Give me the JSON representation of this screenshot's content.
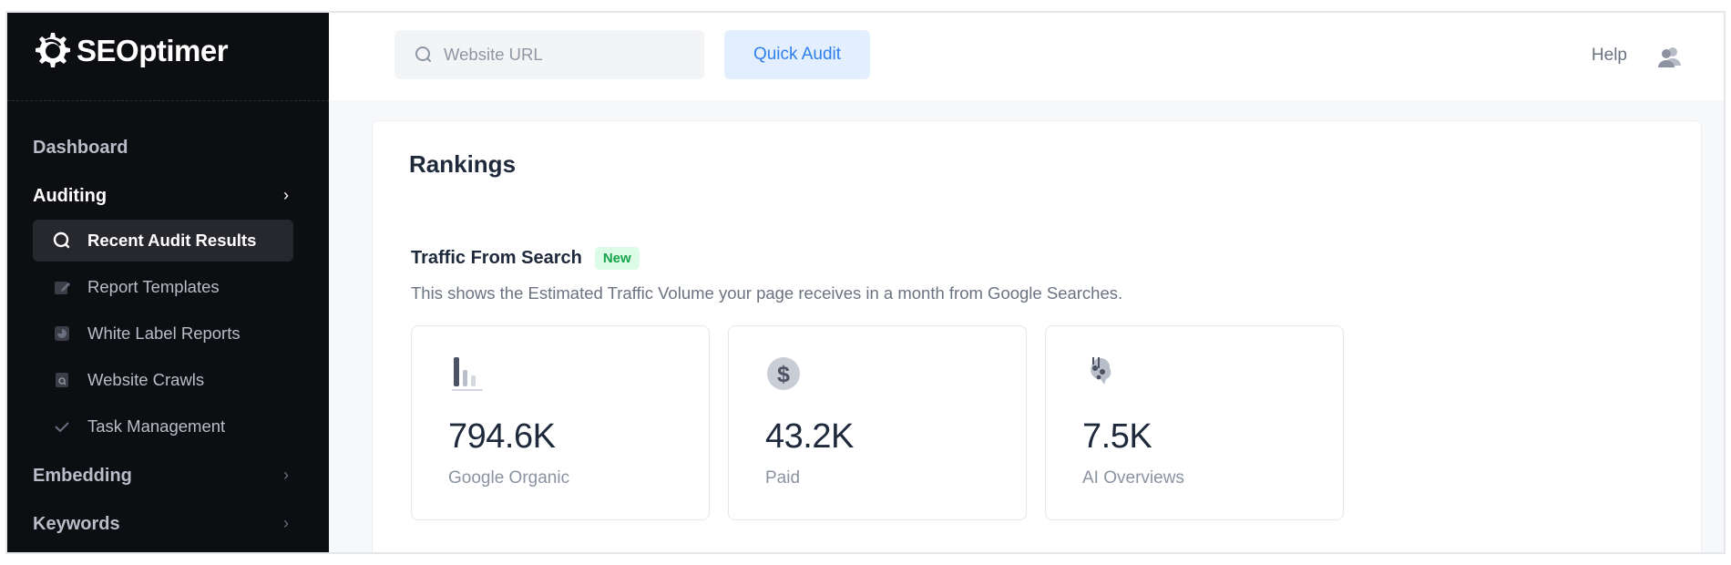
{
  "brand": {
    "name": "SEOptimer"
  },
  "sidebar": {
    "items": [
      {
        "label": "Dashboard",
        "active": false,
        "chevron": false
      },
      {
        "label": "Auditing",
        "active": true,
        "chevron": true
      },
      {
        "label": "Embedding",
        "active": false,
        "chevron": true
      },
      {
        "label": "Keywords",
        "active": false,
        "chevron": true
      }
    ],
    "auditing_subitems": [
      {
        "label": "Recent Audit Results",
        "icon": "search-icon",
        "active": true
      },
      {
        "label": "Report Templates",
        "icon": "edit-document-icon",
        "active": false
      },
      {
        "label": "White Label Reports",
        "icon": "report-chart-icon",
        "active": false
      },
      {
        "label": "Website Crawls",
        "icon": "file-search-icon",
        "active": false
      },
      {
        "label": "Task Management",
        "icon": "check-icon",
        "active": false
      }
    ],
    "chevron_glyph": "›"
  },
  "topbar": {
    "search_placeholder": "Website URL",
    "search_value": "",
    "quick_audit_label": "Quick Audit",
    "help_label": "Help",
    "user_icon": "users-icon"
  },
  "main": {
    "title": "Rankings",
    "section": {
      "title": "Traffic From Search",
      "badge": "New",
      "description": "This shows the Estimated Traffic Volume your page receives in a month from Google Searches."
    },
    "cards": [
      {
        "icon": "bar-chart-icon",
        "value": "794.6K",
        "label": "Google Organic"
      },
      {
        "icon": "dollar-icon",
        "value": "43.2K",
        "label": "Paid"
      },
      {
        "icon": "ai-sparkle-icon",
        "value": "7.5K",
        "label": "AI Overviews"
      }
    ]
  },
  "colors": {
    "sidebar_bg": "#0d0e12",
    "accent": "#2f80ed",
    "badge_green": "#16a34a"
  }
}
